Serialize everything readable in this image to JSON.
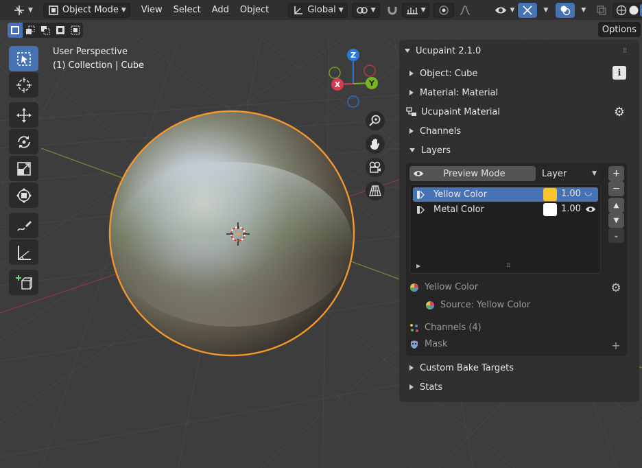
{
  "header": {
    "mode_label": "Object Mode",
    "menus": [
      "View",
      "Select",
      "Add",
      "Object"
    ],
    "transform_orientation": "Global",
    "options_label": "Options"
  },
  "viewport": {
    "perspective_label": "User Perspective",
    "collection_label": "(1) Collection | Cube",
    "gizmo": {
      "z": "Z",
      "x": "X",
      "y": "Y"
    }
  },
  "panel": {
    "title": "Ucupaint 2.1.0",
    "object_row": "Object: Cube",
    "material_row": "Material: Material",
    "ucupaint_material": "Ucupaint Material",
    "channels_row": "Channels",
    "layers_row": "Layers",
    "preview_mode_label": "Preview Mode",
    "layer_select_value": "Layer",
    "layers": [
      {
        "name": "Yellow Color",
        "value": "1.00",
        "color": "#f7c330",
        "selected": true
      },
      {
        "name": "Metal Color",
        "value": "1.00",
        "color": "#ffffff",
        "selected": false
      }
    ],
    "active_layer_name": "Yellow Color",
    "source_label": "Source: Yellow Color",
    "layer_channels_label": "Channels (4)",
    "mask_label": "Mask",
    "custom_bake_label": "Custom Bake Targets",
    "stats_label": "Stats"
  },
  "colors": {
    "accent": "#4772b3",
    "selection_outline": "#f2962e",
    "annotation_arrow": "#e8231c"
  }
}
